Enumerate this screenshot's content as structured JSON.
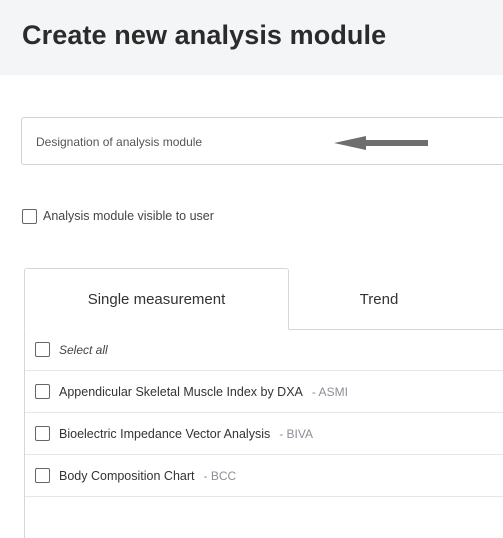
{
  "header": {
    "title": "Create new analysis module"
  },
  "designation": {
    "placeholder": "Designation of analysis module"
  },
  "visibility": {
    "label": "Analysis module visible to user",
    "checked": false
  },
  "tabs": [
    {
      "label": "Single measurement",
      "active": true
    },
    {
      "label": "Trend",
      "active": false
    }
  ],
  "list": {
    "select_all": "Select all",
    "items": [
      {
        "name": "Appendicular Skeletal Muscle Index by DXA",
        "abbr": "- ASMI"
      },
      {
        "name": "Bioelectric Impedance Vector Analysis",
        "abbr": "- BIVA"
      },
      {
        "name": "Body Composition Chart",
        "abbr": "- BCC"
      }
    ]
  },
  "colors": {
    "header_bg": "#f4f5f7",
    "arrow": "#6e6e6e",
    "border": "#d3d7dc"
  },
  "icons": {
    "pointer": "arrow-left-icon"
  }
}
